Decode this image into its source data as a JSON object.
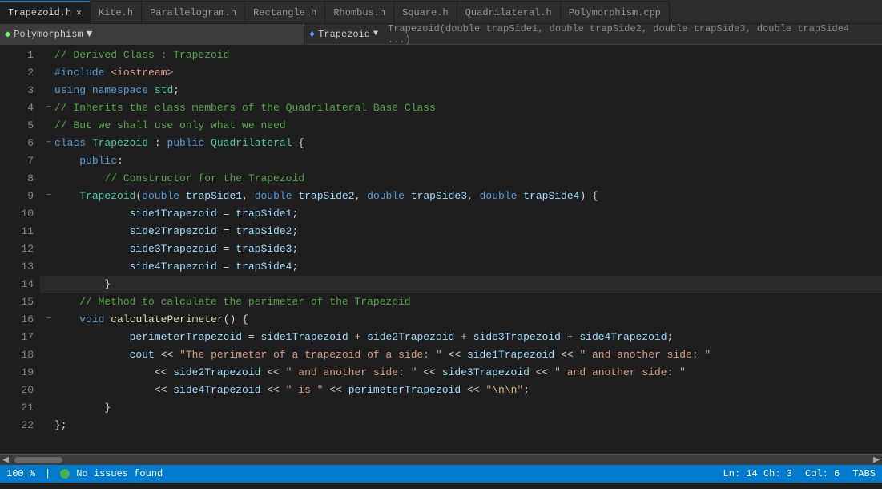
{
  "tabs": [
    {
      "label": "Trapezoid.h",
      "active": true,
      "closeable": true,
      "modified": false
    },
    {
      "label": "Kite.h",
      "active": false,
      "closeable": false
    },
    {
      "label": "Parallelogram.h",
      "active": false,
      "closeable": false
    },
    {
      "label": "Rectangle.h",
      "active": false,
      "closeable": false
    },
    {
      "label": "Rhombus.h",
      "active": false,
      "closeable": false
    },
    {
      "label": "Square.h",
      "active": false,
      "closeable": false
    },
    {
      "label": "Quadrilateral.h",
      "active": false,
      "closeable": false
    },
    {
      "label": "Polymorphism.cpp",
      "active": false,
      "closeable": false
    }
  ],
  "toolbar": {
    "left_dropdown": "Polymorphism",
    "right_dropdown": "Trapezoid",
    "function_hint": "Trapezoid(double trapSide1, double trapSide2, double trapSide3, double trapSide4 ...)"
  },
  "lines": [
    {
      "num": 1,
      "fold": "",
      "code": "<span class='c-comment'>// Derived Class : Trapezoid</span>"
    },
    {
      "num": 2,
      "fold": "",
      "code": "<span class='c-include'>#include</span> <span class='c-string'>&lt;iostream&gt;</span>"
    },
    {
      "num": 3,
      "fold": "",
      "code": "<span class='c-keyword'>using</span> <span class='c-keyword'>namespace</span> <span class='c-namespace'>std</span>;"
    },
    {
      "num": 4,
      "fold": "−",
      "code": "<span class='c-comment'>// Inherits the class members of the Quadrilateral Base Class</span>"
    },
    {
      "num": 5,
      "fold": "",
      "code": "<span class='c-comment'>// But we shall use only what we need</span>"
    },
    {
      "num": 6,
      "fold": "−",
      "code": "<span class='c-keyword'>class</span> <span class='c-class-name'>Trapezoid</span> : <span class='c-keyword'>public</span> <span class='c-class-name'>Quadrilateral</span> {"
    },
    {
      "num": 7,
      "fold": "",
      "code": "<span class='c-access'>public</span>:"
    },
    {
      "num": 8,
      "fold": "",
      "code": "<span class='c-comment'>// Constructor for the Trapezoid</span>"
    },
    {
      "num": 9,
      "fold": "−",
      "code": "<span class='c-class-name'>Trapezoid</span>(<span class='c-keyword'>double</span> <span class='c-param'>trapSide1</span>, <span class='c-keyword'>double</span> <span class='c-param'>trapSide2</span>, <span class='c-keyword'>double</span> <span class='c-param'>trapSide3</span>, <span class='c-keyword'>double</span> <span class='c-param'>trapSide4</span>) {"
    },
    {
      "num": 10,
      "fold": "",
      "code": "<span class='c-var'>side1Trapezoid</span> = <span class='c-param'>trapSide1</span>;"
    },
    {
      "num": 11,
      "fold": "",
      "code": "<span class='c-var'>side2Trapezoid</span> = <span class='c-param'>trapSide2</span>;"
    },
    {
      "num": 12,
      "fold": "",
      "code": "<span class='c-var'>side3Trapezoid</span> = <span class='c-param'>trapSide3</span>;"
    },
    {
      "num": 13,
      "fold": "",
      "code": "<span class='c-var'>side4Trapezoid</span> = <span class='c-param'>trapSide4</span>;"
    },
    {
      "num": 14,
      "fold": "",
      "code": "}"
    },
    {
      "num": 15,
      "fold": "",
      "code": "<span class='c-comment'>// Method to calculate the perimeter of the Trapezoid</span>"
    },
    {
      "num": 16,
      "fold": "−",
      "code": "<span class='c-keyword'>void</span> <span class='c-func'>calculatePerimeter</span>() {"
    },
    {
      "num": 17,
      "fold": "",
      "code": "<span class='c-var'>perimeterTrapezoid</span> = <span class='c-var'>side1Trapezoid</span> + <span class='c-var'>side2Trapezoid</span> + <span class='c-var'>side3Trapezoid</span> + <span class='c-var'>side4Trapezoid</span>;"
    },
    {
      "num": 18,
      "fold": "",
      "code": "<span class='c-stream'>cout</span> &lt;&lt; <span class='c-string'>\"The perimeter of a trapezoid of a side: \"</span> &lt;&lt; <span class='c-var'>side1Trapezoid</span> &lt;&lt; <span class='c-string'>\" and another side: \"</span>"
    },
    {
      "num": 19,
      "fold": "",
      "code": "&lt;&lt; <span class='c-var'>side2Trapezoid</span> &lt;&lt; <span class='c-string'>\" and another side: \"</span> &lt;&lt; <span class='c-var'>side3Trapezoid</span> &lt;&lt; <span class='c-string'>\" and another side: \"</span>"
    },
    {
      "num": 20,
      "fold": "",
      "code": "&lt;&lt; <span class='c-var'>side4Trapezoid</span> &lt;&lt; <span class='c-string'>\" is \"</span> &lt;&lt; <span class='c-var'>perimeterTrapezoid</span> &lt;&lt; <span class='c-string'>\"\\n\\n\"</span>;"
    },
    {
      "num": 21,
      "fold": "",
      "code": "}"
    },
    {
      "num": 22,
      "fold": "",
      "code": "};"
    }
  ],
  "indents": {
    "1": 0,
    "2": 0,
    "3": 0,
    "4": 0,
    "5": 0,
    "6": 0,
    "7": 1,
    "8": 2,
    "9": 1,
    "10": 3,
    "11": 3,
    "12": 3,
    "13": 3,
    "14": 2,
    "15": 1,
    "16": 1,
    "17": 3,
    "18": 3,
    "19": 4,
    "20": 4,
    "21": 2,
    "22": 0
  },
  "status": {
    "zoom": "100 %",
    "issues": "No issues found",
    "position": "Ln: 14  Ch: 3",
    "col": "Col: 6",
    "tabs_label": "TABS"
  }
}
